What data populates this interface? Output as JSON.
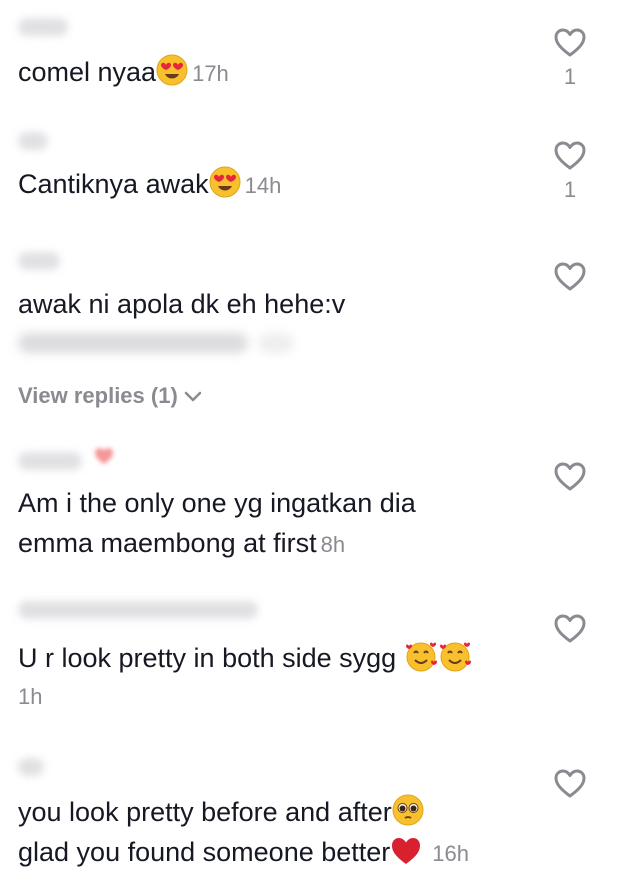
{
  "comments": [
    {
      "text": "comel nyaa",
      "emoji": "heart-eyes-emoji",
      "time": "17h",
      "likes": "1"
    },
    {
      "text": "Cantiknya awak",
      "emoji": "heart-eyes-emoji",
      "time": "14h",
      "likes": "1"
    },
    {
      "text": "awak ni apola dk eh hehe:v",
      "view_replies": "View replies (1)"
    },
    {
      "line1": "Am i the only one yg ingatkan dia",
      "line2": "emma maembong at first",
      "time": "8h"
    },
    {
      "text": "U r look pretty in both side sygg",
      "emoji": "smiling-face-with-hearts-emoji",
      "time": "1h"
    },
    {
      "line1": "you look pretty before and after",
      "line2": "glad you found someone better",
      "emoji1": "pleading-face-emoji",
      "emoji2": "red-heart-emoji",
      "time": "16h"
    }
  ],
  "colors": {
    "text": "#161823",
    "muted": "#8a8b91",
    "icon": "#8a8b91"
  }
}
